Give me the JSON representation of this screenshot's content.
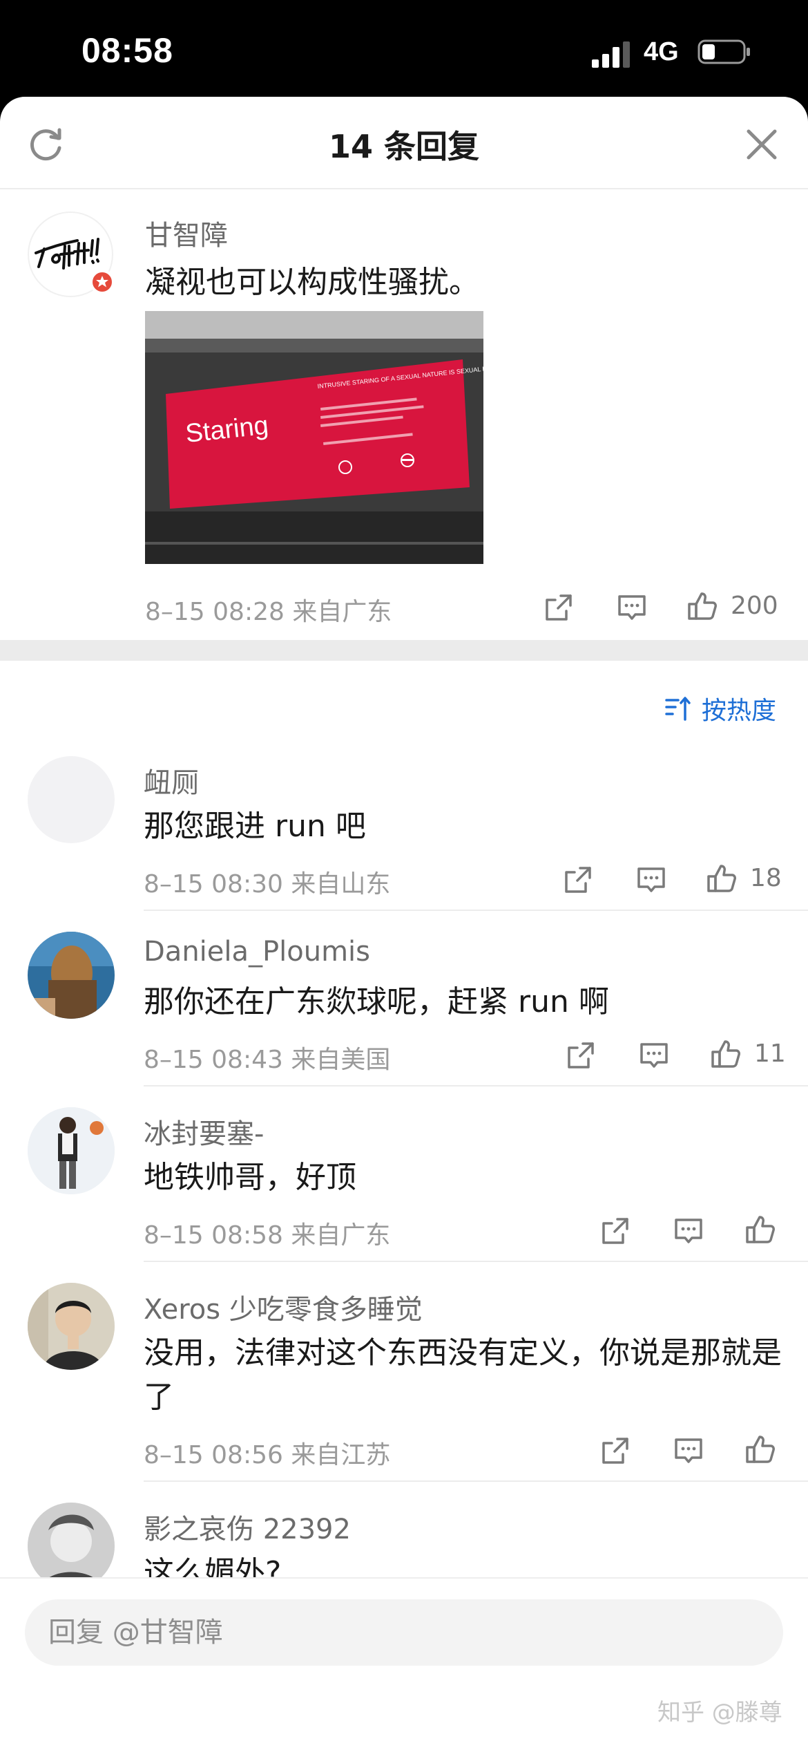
{
  "status_bar": {
    "time": "08:58",
    "network": "4G"
  },
  "sheet": {
    "title": "14 条回复"
  },
  "main_comment": {
    "author": "甘智障",
    "text": "凝视也可以构成性骚扰。",
    "image": {
      "poster_word": "Staring",
      "poster_heading": "INTRUSIVE STARING OF A SEXUAL NATURE IS SEXUAL HARASSMENT AND IS NOT TOLERATED",
      "poster_color": "#d8153e"
    },
    "meta": "8–15 08:28 来自广东",
    "likes": "200"
  },
  "sort": {
    "label": "按热度"
  },
  "replies": [
    {
      "author": "衄厕",
      "text": "那您跟进 run 吧",
      "meta": "8–15 08:30 来自山东",
      "likes": "18"
    },
    {
      "author": "Daniela_Ploumis",
      "text": "那你还在广东欻球呢，赶紧 run 啊",
      "meta": "8–15 08:43 来自美国",
      "likes": "11"
    },
    {
      "author": "冰封要塞-",
      "text": "地铁帅哥，好顶",
      "meta": "8–15 08:58 来自广东",
      "likes": ""
    },
    {
      "author": "Xeros 少吃零食多睡觉",
      "text": "没用，法律对这个东西没有定义，你说是那就是了",
      "meta": "8–15 08:56 来自江苏",
      "likes": ""
    },
    {
      "author": "影之哀伤 22392",
      "text": "这么媚外?",
      "meta": "",
      "likes": ""
    }
  ],
  "reply_bar": {
    "placeholder": "回复 @甘智障"
  },
  "watermark": "知乎 @滕尊",
  "colors": {
    "accent_blue": "#1e6fd6",
    "badge_red": "#e64a3b",
    "meta_gray": "#9a9a9a"
  }
}
